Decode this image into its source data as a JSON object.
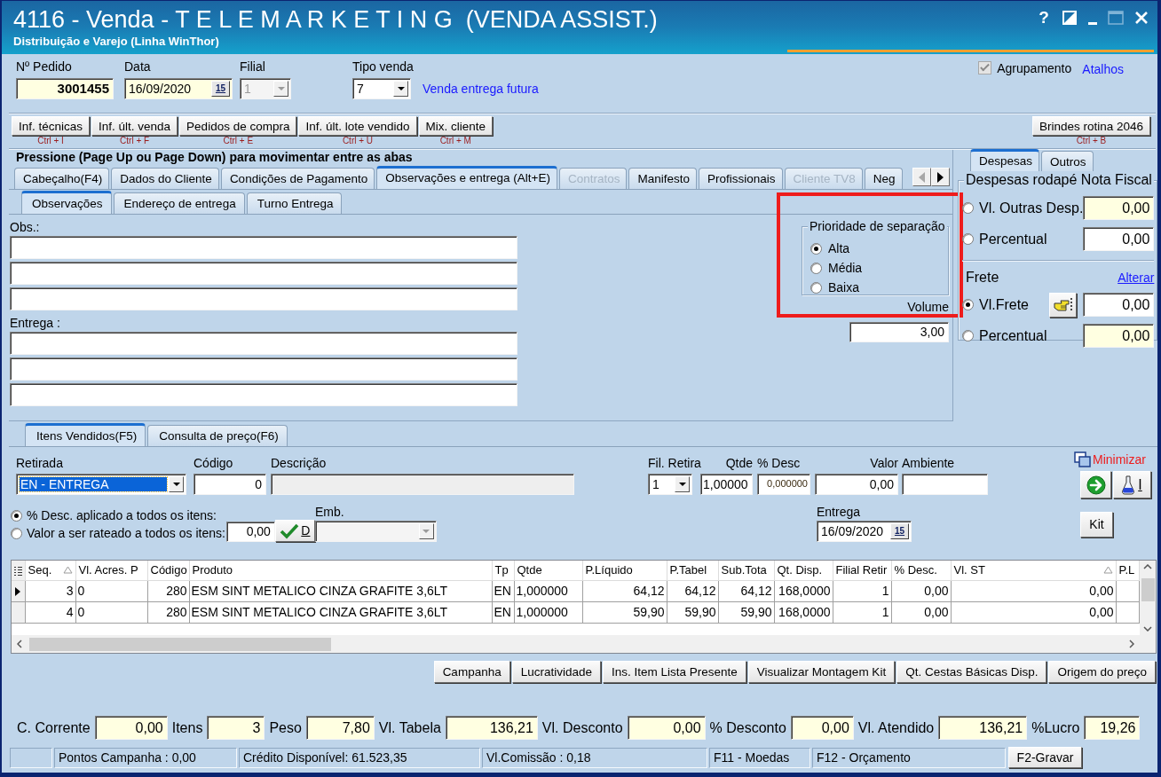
{
  "window": {
    "title": "4116 - Venda - T E L E M A R K E T I N G  (VENDA ASSIST.)",
    "subtitle": "Distribuição e Varejo (Linha WinThor)",
    "title_buttons": [
      {
        "kind": "help",
        "label": "?",
        "disabled": false
      },
      {
        "kind": "restore",
        "disabled": false
      },
      {
        "kind": "minimize",
        "disabled": false
      },
      {
        "kind": "maximize",
        "disabled": true
      },
      {
        "kind": "close",
        "disabled": false
      }
    ]
  },
  "header": {
    "order_number": {
      "label": "Nº Pedido",
      "value": "3001455"
    },
    "date": {
      "label": "Data",
      "value": "16/09/2020",
      "calendar_button": "15"
    },
    "branch": {
      "label": "Filial",
      "value": "1",
      "disabled": true
    },
    "sale_type": {
      "label": "Tipo venda",
      "value": "7",
      "description": "Venda entrega futura"
    },
    "grouping": {
      "label": "Agrupamento",
      "checked": true,
      "disabled": true
    },
    "shortcuts_link": "Atalhos"
  },
  "toolbar": {
    "buttons": [
      {
        "label": "Inf. técnicas",
        "shortcut": "Ctrl + I"
      },
      {
        "label": "Inf. últ. venda",
        "shortcut": "Ctrl + F"
      },
      {
        "label": "Pedidos de compra",
        "shortcut": "Ctrl + E"
      },
      {
        "label": "Inf. últ. lote vendido",
        "shortcut": "Ctrl + U"
      },
      {
        "label": "Mix. cliente",
        "shortcut": "Ctrl + M"
      }
    ],
    "right_button": {
      "label": "Brindes rotina 2046",
      "shortcut": "Ctrl + B"
    }
  },
  "page_hint": "Pressione (Page Up ou Page Down) para movimentar entre as abas",
  "tabs": [
    {
      "label": "Cabeçalho(F4)",
      "selected": false,
      "disabled": false
    },
    {
      "label": "Dados do Cliente",
      "selected": false,
      "disabled": false
    },
    {
      "label": "Condições de Pagamento",
      "selected": false,
      "disabled": false
    },
    {
      "label": "Observações e entrega (Alt+E)",
      "selected": true,
      "disabled": false
    },
    {
      "label": "Contratos",
      "selected": false,
      "disabled": true
    },
    {
      "label": "Manifesto",
      "selected": false,
      "disabled": false
    },
    {
      "label": "Profissionais",
      "selected": false,
      "disabled": false
    },
    {
      "label": "Cliente TV8",
      "selected": false,
      "disabled": true
    },
    {
      "label": "Neg",
      "selected": false,
      "disabled": false
    }
  ],
  "tab_scroll": [
    {
      "kind": "left",
      "disabled": true
    },
    {
      "kind": "right",
      "disabled": false
    }
  ],
  "subtabs": [
    {
      "label": "Observações",
      "selected": true
    },
    {
      "label": "Endereço de entrega",
      "selected": false
    },
    {
      "label": "Turno Entrega",
      "selected": false
    }
  ],
  "observations": {
    "label": "Obs.:",
    "fields": [
      {
        "kind": "text"
      },
      {
        "kind": "text"
      },
      {
        "kind": "text"
      }
    ]
  },
  "delivery_notes": {
    "label": "Entrega :",
    "fields": [
      {
        "kind": "text"
      },
      {
        "kind": "text"
      },
      {
        "kind": "text"
      }
    ]
  },
  "priority": {
    "legend": "Prioridade de separação",
    "highlighted": true,
    "options": [
      {
        "label": "Alta",
        "selected": true
      },
      {
        "label": "Média",
        "selected": false
      },
      {
        "label": "Baixa",
        "selected": false
      }
    ]
  },
  "volume": {
    "label": "Volume",
    "value": "3,00"
  },
  "expenses": {
    "tabs": [
      {
        "label": "Despesas",
        "selected": true
      },
      {
        "label": "Outros",
        "selected": false
      }
    ],
    "title": "Despesas rodapé Nota Fiscal",
    "rows": [
      {
        "kind": "plain",
        "label": "Vl. Outras Desp.",
        "value": "0,00",
        "selected": false,
        "highlighted": true
      },
      {
        "kind": "plain",
        "label": "Percentual",
        "value": "0,00",
        "selected": false,
        "highlighted": false
      }
    ],
    "freight_title": "Frete",
    "freight_link": "Alterar",
    "freight_rows": [
      {
        "kind": "button",
        "label": "Vl.Frete",
        "value": "0,00",
        "selected": true,
        "highlighted": false
      },
      {
        "kind": "plain",
        "label": "Percentual",
        "value": "0,00",
        "selected": false,
        "highlighted": true
      }
    ]
  },
  "item_tabs": [
    {
      "label": "Itens Vendidos(F5)",
      "selected": true
    },
    {
      "label": "Consulta de preço(F6)",
      "selected": false
    }
  ],
  "item_entry": {
    "pickup": {
      "label": "Retirada",
      "value": "EN - ENTREGA",
      "focused": true
    },
    "code": {
      "label": "Código",
      "value": "0"
    },
    "description": {
      "label": "Descrição",
      "disabled": true
    },
    "pickup_branch": {
      "label": "Fil. Retira",
      "value": "1"
    },
    "quantity": {
      "label": "Qtde",
      "value": "1,00000"
    },
    "discount": {
      "label": "% Desc",
      "value": "0,000000"
    },
    "price": {
      "label": "Valor",
      "value": "0,00"
    },
    "environment": {
      "label": "Ambiente"
    },
    "minimize_link": "Minimizar",
    "discount_modes": [
      {
        "label": "% Desc. aplicado a todos os itens:",
        "selected": true
      },
      {
        "label": "Valor a ser rateado a todos os itens:",
        "selected": false
      }
    ],
    "apportion_value": "0,00",
    "apply_button": "D",
    "packaging": {
      "label": "Emb.",
      "disabled": true
    },
    "delivery": {
      "label": "Entrega",
      "value": "16/09/2020",
      "calendar_button": "15"
    },
    "side_buttons": [
      {
        "kind": "go"
      },
      {
        "kind": "flask",
        "label": "I"
      }
    ],
    "kit_button": "Kit"
  },
  "grid": {
    "columns": [
      {
        "label": "Seq.",
        "sorted": true
      },
      {
        "label": "Vl. Acres. P",
        "sorted": false
      },
      {
        "label": "Código",
        "sorted": false
      },
      {
        "label": "Produto",
        "sorted": false
      },
      {
        "label": "Tp",
        "sorted": false
      },
      {
        "label": "Qtde",
        "sorted": false
      },
      {
        "label": "P.Líquido",
        "sorted": false
      },
      {
        "label": "P.Tabel",
        "sorted": false
      },
      {
        "label": "Sub.Tota",
        "sorted": false
      },
      {
        "label": "Qt. Disp.",
        "sorted": false
      },
      {
        "label": "Filial Retir",
        "sorted": false
      },
      {
        "label": "% Desc.",
        "sorted": false
      },
      {
        "label": "Vl. ST",
        "sorted": true
      },
      {
        "label": "P.L",
        "sorted": false
      }
    ],
    "rows": [
      {
        "selected": true,
        "cells": [
          "3",
          "0",
          "280",
          "ESM SINT METALICO CINZA GRAFITE 3,6LT",
          "EN",
          "1,000000",
          "64,12",
          "64,12",
          "64,12",
          "168,0000",
          "1",
          "0,00",
          "0,00"
        ]
      },
      {
        "selected": false,
        "cells": [
          "4",
          "0",
          "280",
          "ESM SINT METALICO CINZA GRAFITE 3,6LT",
          "EN",
          "1,000000",
          "59,90",
          "59,90",
          "59,90",
          "168,0000",
          "1",
          "0,00",
          "0,00"
        ]
      }
    ]
  },
  "actions": [
    "Campanha",
    "Lucratividade",
    "Ins. Item Lista Presente",
    "Visualizar Montagem Kit",
    "Qt. Cestas Básicas Disp.",
    "Origem do preço"
  ],
  "totals": [
    {
      "label": "C. Corrente",
      "value": "0,00"
    },
    {
      "label": "Itens",
      "value": "3"
    },
    {
      "label": "Peso",
      "value": "7,80"
    },
    {
      "label": "Vl. Tabela",
      "value": "136,21"
    },
    {
      "label": "Vl. Desconto",
      "value": "0,00"
    },
    {
      "label": "% Desconto",
      "value": "0,00"
    },
    {
      "label": "Vl. Atendido",
      "value": "136,21"
    },
    {
      "label": "%Lucro",
      "value": "19,26"
    }
  ],
  "status_bar": {
    "panels": [
      "Pontos Campanha : 0,00",
      "Crédito Disponível: 61.523,35",
      "Vl.Comissão : 0,18",
      "F11 - Moedas",
      "F12 - Orçamento"
    ],
    "save_button": "F2-Gravar"
  }
}
